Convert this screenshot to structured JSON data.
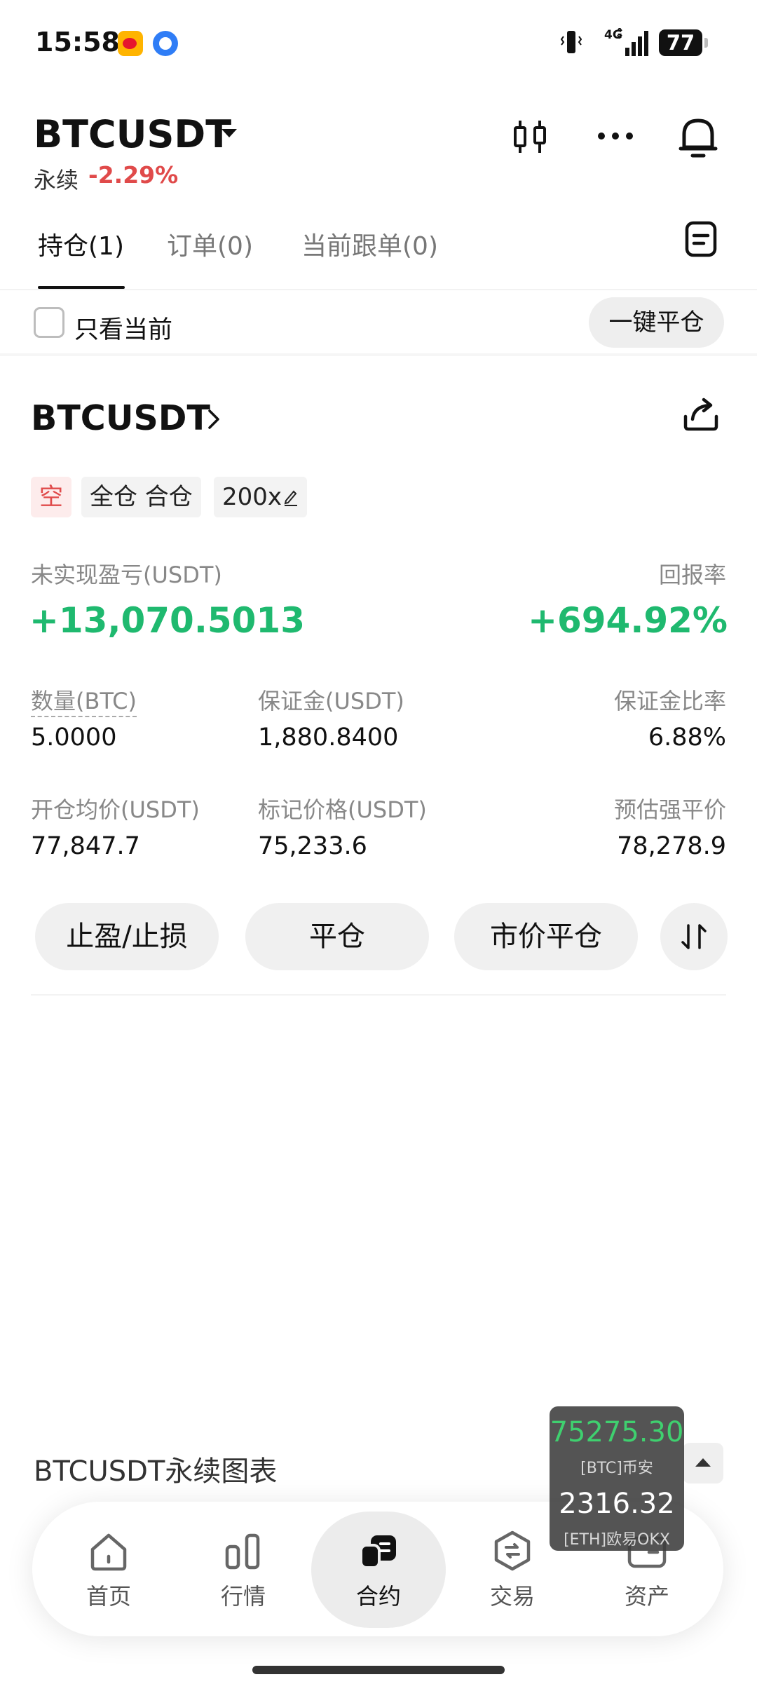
{
  "status_bar": {
    "time": "15:58",
    "network": "4G",
    "battery": "77",
    "icons": [
      "weibo-app-icon",
      "blue-bird-app-icon",
      "vibrate-icon",
      "signal-icon",
      "battery-icon"
    ]
  },
  "header": {
    "symbol": "BTCUSDT",
    "type_label": "永续",
    "change": "-2.29%",
    "icons": [
      "candlestick-chart-icon",
      "more-icon",
      "bell-icon"
    ]
  },
  "tabs": [
    {
      "label": "持仓(1)",
      "active": true
    },
    {
      "label": "订单(0)",
      "active": false
    },
    {
      "label": "当前跟单(0)",
      "active": false
    }
  ],
  "filter": {
    "only_current_label": "只看当前",
    "close_all_label": "一键平仓"
  },
  "position": {
    "symbol": "BTCUSDT",
    "tags": {
      "side": "空",
      "mode": "全仓 合仓",
      "leverage": "200x"
    },
    "unrealized_pnl_label": "未实现盈亏(USDT)",
    "unrealized_pnl": "+13,070.5013",
    "roe_label": "回报率",
    "roe": "+694.92%",
    "fields": {
      "quantity_label": "数量(BTC)",
      "quantity": "5.0000",
      "margin_label": "保证金(USDT)",
      "margin": "1,880.8400",
      "margin_ratio_label": "保证金比率",
      "margin_ratio": "6.88%",
      "entry_price_label": "开仓均价(USDT)",
      "entry_price": "77,847.7",
      "mark_price_label": "标记价格(USDT)",
      "mark_price": "75,233.6",
      "liq_price_label": "预估强平价",
      "liq_price": "78,278.9"
    },
    "actions": {
      "tpsl": "止盈/止损",
      "close": "平仓",
      "market_close": "市价平仓"
    }
  },
  "chart_section": {
    "title": "BTCUSDT永续图表"
  },
  "bottom_nav": [
    {
      "label": "首页",
      "icon": "home-icon",
      "active": false
    },
    {
      "label": "行情",
      "icon": "market-icon",
      "active": false
    },
    {
      "label": "合约",
      "icon": "futures-icon",
      "active": true
    },
    {
      "label": "交易",
      "icon": "trade-icon",
      "active": false
    },
    {
      "label": "资产",
      "icon": "wallet-icon",
      "active": false
    }
  ],
  "ticker_overlay": {
    "btc_price": "75275.30",
    "btc_source": "[BTC]币安",
    "eth_price": "2316.32",
    "eth_source": "[ETH]欧易OKX"
  },
  "colors": {
    "up_green": "#1fb96f",
    "down_red": "#e04a4a"
  }
}
